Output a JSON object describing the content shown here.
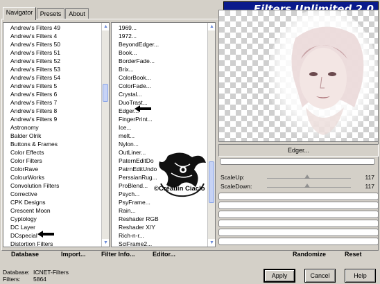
{
  "tabs": [
    "Navigator",
    "Presets",
    "About"
  ],
  "title": "Filters Unlimited 2.0",
  "categories": [
    "Andrew's Filters 49",
    "Andrew's Filters 4",
    "Andrew's Filters 50",
    "Andrew's Filters 51",
    "Andrew's Filters 52",
    "Andrew's Filters 53",
    "Andrew's Filters 54",
    "Andrew's Filters 5",
    "Andrew's Filters 6",
    "Andrew's Filters 7",
    "Andrew's Filters 8",
    "Andrew's Filters 9",
    "Astronomy",
    "Balder Olrik",
    "Buttons & Frames",
    "Color Effects",
    "Color Filters",
    "ColorRave",
    "ColourWorks",
    "Convolution Filters",
    "Corrective",
    "CPK Designs",
    "Crescent Moon",
    "Cyptology",
    "DC Layer",
    "DCspecial",
    "Distortion Filters"
  ],
  "filters": [
    "1969...",
    "1972...",
    "BeyondEdger...",
    "Book...",
    "BorderFade...",
    "Brix...",
    "ColorBook...",
    "ColorFade...",
    "Crystal...",
    "DuoTrast...",
    "Edger...",
    "FingerPrint...",
    "Ice...",
    "melt...",
    "Nylon...",
    "OutLiner...",
    "PaternEditDo",
    "PatrnEditUndo",
    "PerssianRug...",
    "ProBlend...",
    "Psych...",
    "PsyFrame...",
    "Rain...",
    "Reshader RGB",
    "Reshader X/Y",
    "Rich-n-r...",
    "SciFrame2..."
  ],
  "selected_filter": "Edger...",
  "sliders": [
    {
      "label": "ScaleUp:",
      "value": "117",
      "level": 0.48
    },
    {
      "label": "ScaleDown:",
      "value": "117",
      "level": 0.48
    }
  ],
  "watermark_text": "©Créatiin Ciaclo",
  "bottom": {
    "database": "Database",
    "import": "Import...",
    "filter_info": "Filter Info...",
    "editor": "Editor...",
    "randomize": "Randomize",
    "reset": "Reset"
  },
  "status": {
    "database_label": "Database:",
    "database_value": "ICNET-Filters",
    "filters_label": "Filters:",
    "filters_value": "5864"
  },
  "buttons": {
    "apply": "Apply",
    "cancel": "Cancel",
    "help": "Help"
  },
  "colors": {
    "title_bg": "#0a1a8c",
    "scroll_accent": "#6b8ad8"
  }
}
